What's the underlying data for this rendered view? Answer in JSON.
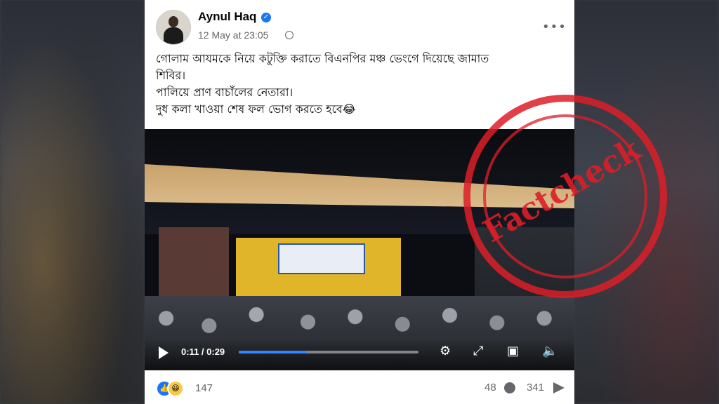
{
  "author": {
    "name": "Aynul Haq",
    "verified_icon": "verified-badge-icon"
  },
  "meta": {
    "timestamp": "12 May at 23:05",
    "privacy_icon": "globe-icon"
  },
  "more_icon": "more-options-icon",
  "post_lines": [
    "গোলাম আযমকে নিয়ে কটুক্তি করাতে বিএনপির মঞ্চ ভেংগে দিয়েছে জামাত",
    "শিবির।",
    "পালিয়ে প্রাণ বাচাঁলের নেতারা।",
    "দুধ কলা খাওয়া শেষ ফল ভোগ করতে হবে😂"
  ],
  "video": {
    "time_current": "0:11",
    "time_total": "0:29",
    "time_display": "0:11 / 0:29",
    "progress": 0.38,
    "controls": [
      "settings-icon",
      "fullscreen-icon",
      "pip-icon",
      "volume-icon"
    ]
  },
  "stamp": {
    "text": "Factcheck",
    "color": "#dc1e28"
  },
  "footer": {
    "reaction_count": "147",
    "comment_count": "48",
    "share_count": "341"
  },
  "colors": {
    "accent": "#1877f2",
    "secondary_text": "#65676b"
  }
}
